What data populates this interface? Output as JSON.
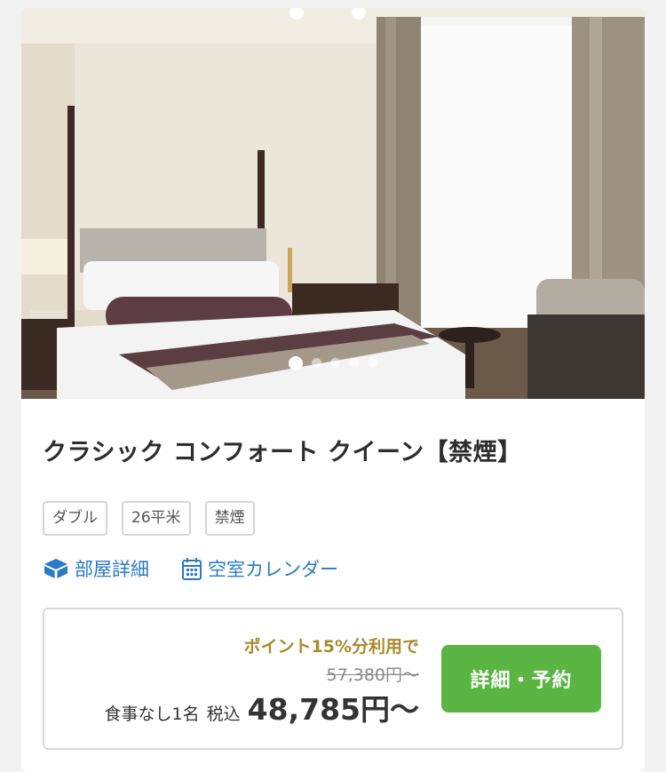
{
  "room": {
    "title": "クラシック コンフォート クイーン【禁煙】",
    "tags": [
      "ダブル",
      "26平米",
      "禁煙"
    ]
  },
  "carousel": {
    "slide_count": 5,
    "active_index": 0
  },
  "links": {
    "room_detail": {
      "label": "部屋詳細",
      "icon": "cube-icon"
    },
    "calendar": {
      "label": "空室カレンダー",
      "icon": "calendar-icon"
    }
  },
  "plan": {
    "point_note": "ポイント15%分利用で",
    "original_price": "57,380円〜",
    "meal": "食事なし1名",
    "tax_label": "税込",
    "price": "48,785円〜",
    "cta_label": "詳細・予約"
  },
  "colors": {
    "link": "#2a7ac5",
    "cta": "#5ab542",
    "point": "#a88a2c"
  }
}
